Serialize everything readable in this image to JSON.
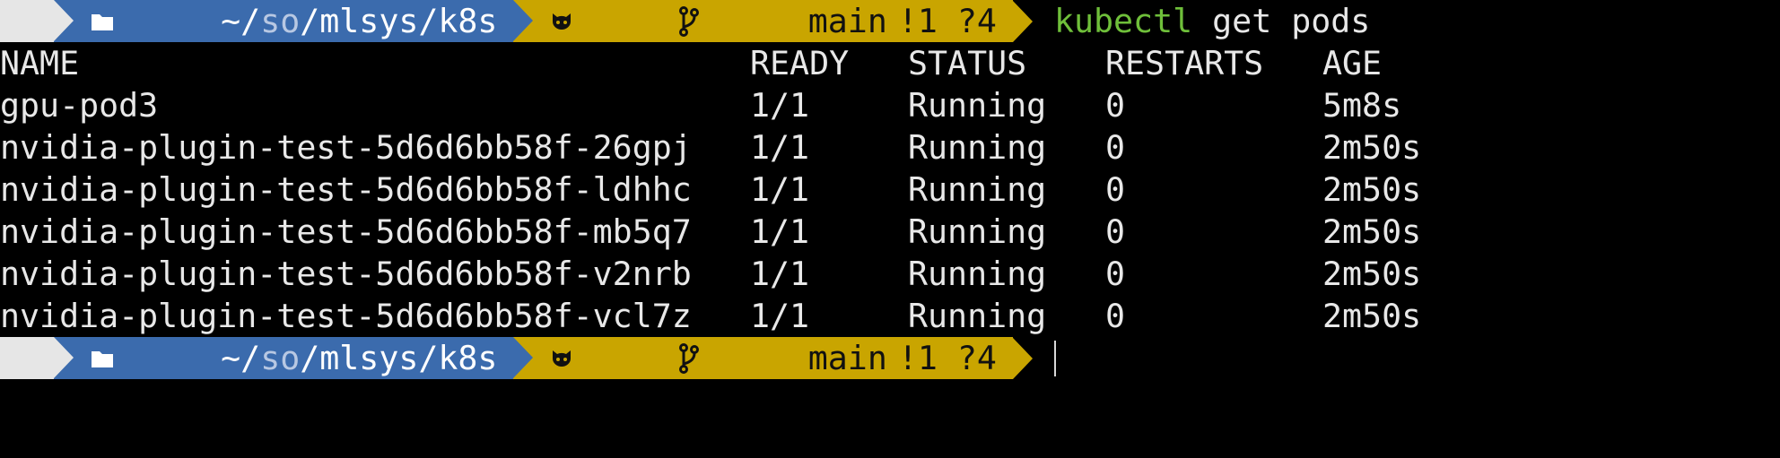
{
  "prompt": {
    "os_icon": "ubuntu-icon",
    "folder_icon": "folder-icon",
    "dir_home": "~/",
    "dir_so": "so",
    "dir_rest": "/mlsys/k8s",
    "git_icon": "github-icon",
    "branch_icon": "git-branch-icon",
    "branch": "main",
    "status": "!1 ?4",
    "colors": {
      "os_bg": "#e6e6e6",
      "dir_bg": "#3b6bad",
      "git_bg": "#c9a500"
    }
  },
  "command": {
    "program": "kubectl",
    "args": "get pods"
  },
  "table": {
    "headers": [
      "NAME",
      "READY",
      "STATUS",
      "RESTARTS",
      "AGE"
    ],
    "rows": [
      [
        "gpu-pod3",
        "1/1",
        "Running",
        "0",
        "5m8s"
      ],
      [
        "nvidia-plugin-test-5d6d6bb58f-26gpj",
        "1/1",
        "Running",
        "0",
        "2m50s"
      ],
      [
        "nvidia-plugin-test-5d6d6bb58f-ldhhc",
        "1/1",
        "Running",
        "0",
        "2m50s"
      ],
      [
        "nvidia-plugin-test-5d6d6bb58f-mb5q7",
        "1/1",
        "Running",
        "0",
        "2m50s"
      ],
      [
        "nvidia-plugin-test-5d6d6bb58f-v2nrb",
        "1/1",
        "Running",
        "0",
        "2m50s"
      ],
      [
        "nvidia-plugin-test-5d6d6bb58f-vcl7z",
        "1/1",
        "Running",
        "0",
        "2m50s"
      ]
    ]
  }
}
